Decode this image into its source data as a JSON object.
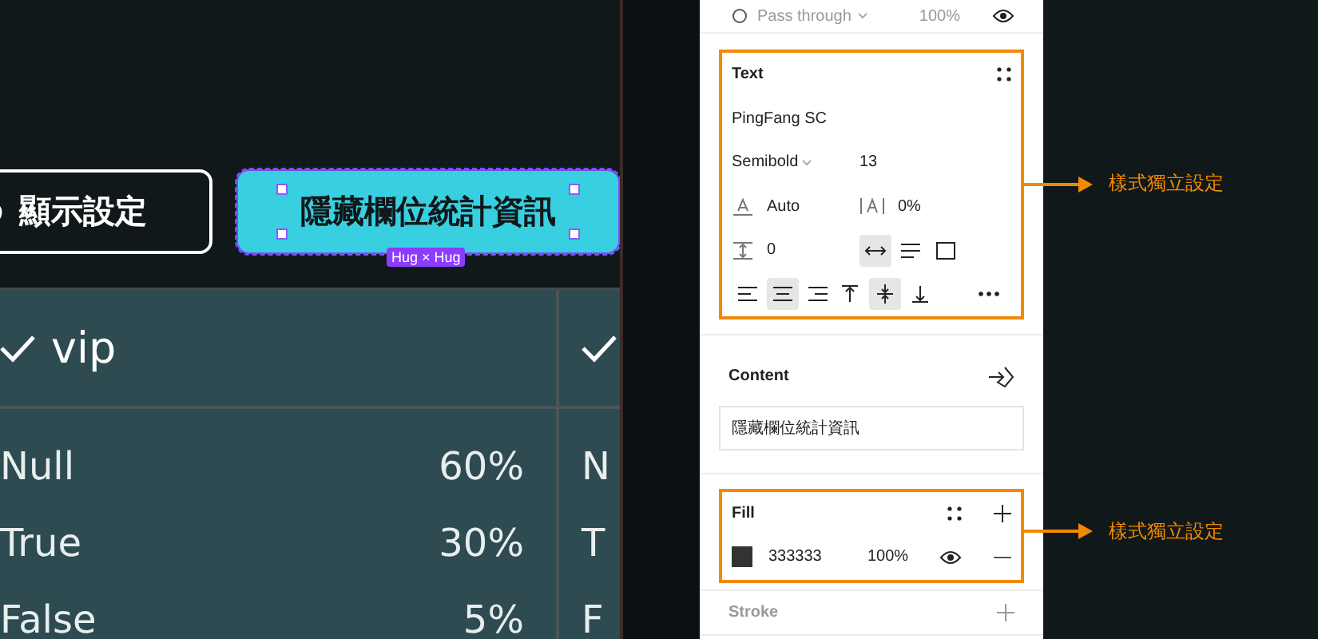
{
  "canvas": {
    "buttons": [
      {
        "label": "顯示設定",
        "kind": "outline"
      },
      {
        "label": "隱藏欄位統計資訊",
        "kind": "filled",
        "selected": true
      }
    ],
    "size_badge": "Hug × Hug",
    "table": {
      "columns": [
        {
          "header": "vip",
          "checked": true,
          "rows": [
            {
              "label": "Null",
              "value": "60%"
            },
            {
              "label": "True",
              "value": "30%"
            },
            {
              "label": "False",
              "value": "5%"
            }
          ]
        },
        {
          "checked": true,
          "rows": [
            {
              "label": "N"
            },
            {
              "label": "T"
            },
            {
              "label": "F"
            }
          ]
        }
      ]
    }
  },
  "panel": {
    "layer": {
      "blend": "Pass through",
      "opacity": "100%"
    },
    "text": {
      "title": "Text",
      "font": "PingFang SC",
      "weight": "Semibold",
      "size": "13",
      "line_height": "Auto",
      "letter_spacing": "0%",
      "paragraph_spacing": "0",
      "resize": [
        {
          "kind": "auto-width",
          "selected": true
        },
        {
          "kind": "auto-height",
          "selected": false
        },
        {
          "kind": "fixed",
          "selected": false
        }
      ],
      "align_h": [
        {
          "kind": "left",
          "selected": false
        },
        {
          "kind": "center",
          "selected": true
        },
        {
          "kind": "right",
          "selected": false
        }
      ],
      "align_v": [
        {
          "kind": "top",
          "selected": false
        },
        {
          "kind": "middle",
          "selected": true
        },
        {
          "kind": "bottom",
          "selected": false
        }
      ]
    },
    "content": {
      "title": "Content",
      "value": "隱藏欄位統計資訊"
    },
    "fill": {
      "title": "Fill",
      "hex": "333333",
      "color": "#333333",
      "opacity": "100%"
    },
    "stroke": {
      "title": "Stroke"
    }
  },
  "annotations": [
    {
      "label": "樣式獨立設定"
    },
    {
      "label": "樣式獨立設定"
    }
  ]
}
